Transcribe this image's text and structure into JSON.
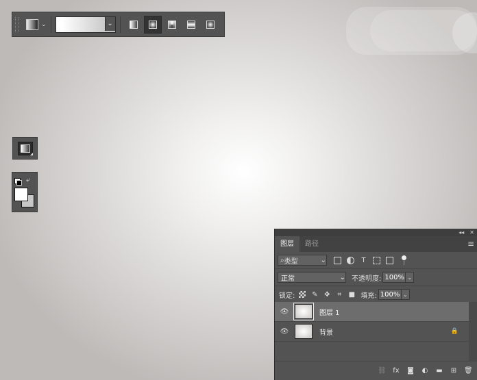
{
  "options_bar": {
    "tool_icon": "gradient-tool-icon",
    "chevron": "⌄",
    "gradient_picker_chevron": "⌄",
    "gradient_types": [
      {
        "name": "linear-gradient-icon",
        "active": false
      },
      {
        "name": "radial-gradient-icon",
        "active": true
      },
      {
        "name": "angle-gradient-icon",
        "active": false
      },
      {
        "name": "reflected-gradient-icon",
        "active": false
      },
      {
        "name": "diamond-gradient-icon",
        "active": false
      }
    ]
  },
  "tools": {
    "active_tool_icon": "gradient-tool-icon",
    "swap_icon": "⤶",
    "foreground_color": "#ffffff",
    "background_color": "#c8c8c8"
  },
  "layers_panel": {
    "collapse_icon": "◂◂",
    "close_icon": "✕",
    "tabs": [
      {
        "label": "图层",
        "active": true
      },
      {
        "label": "路径",
        "active": false
      }
    ],
    "menu_icon": "≡",
    "filter": {
      "search_icon": "⌕",
      "label": "类型",
      "chevron": "⌄",
      "icons": [
        "image-filter-icon",
        "adjustment-filter-icon",
        "type-filter-icon",
        "shape-filter-icon",
        "smart-object-filter-icon"
      ],
      "type_glyph": "T"
    },
    "blend_mode": "正常",
    "blend_chevron": "⌄",
    "opacity_label": "不透明度:",
    "opacity_value": "100%",
    "lock_label": "锁定:",
    "fill_label": "填充:",
    "fill_value": "100%",
    "value_chevron": "⌄",
    "layers": [
      {
        "name": "图层 1",
        "selected": true,
        "visible": true,
        "locked": false
      },
      {
        "name": "背景",
        "selected": false,
        "visible": true,
        "locked": true
      }
    ],
    "eye_glyph": "👁",
    "lock_glyph": "🔒",
    "bottom_icons": {
      "link": "⛓",
      "fx": "fx",
      "mask": "◙",
      "adjust": "◐",
      "folder": "▬",
      "new": "⊞",
      "delete": "🗑"
    }
  },
  "colors": {
    "panel_bg": "#535353",
    "selected_layer": "#6d6d6d",
    "canvas_center": "#ffffff",
    "canvas_edge": "#bdbab8"
  }
}
